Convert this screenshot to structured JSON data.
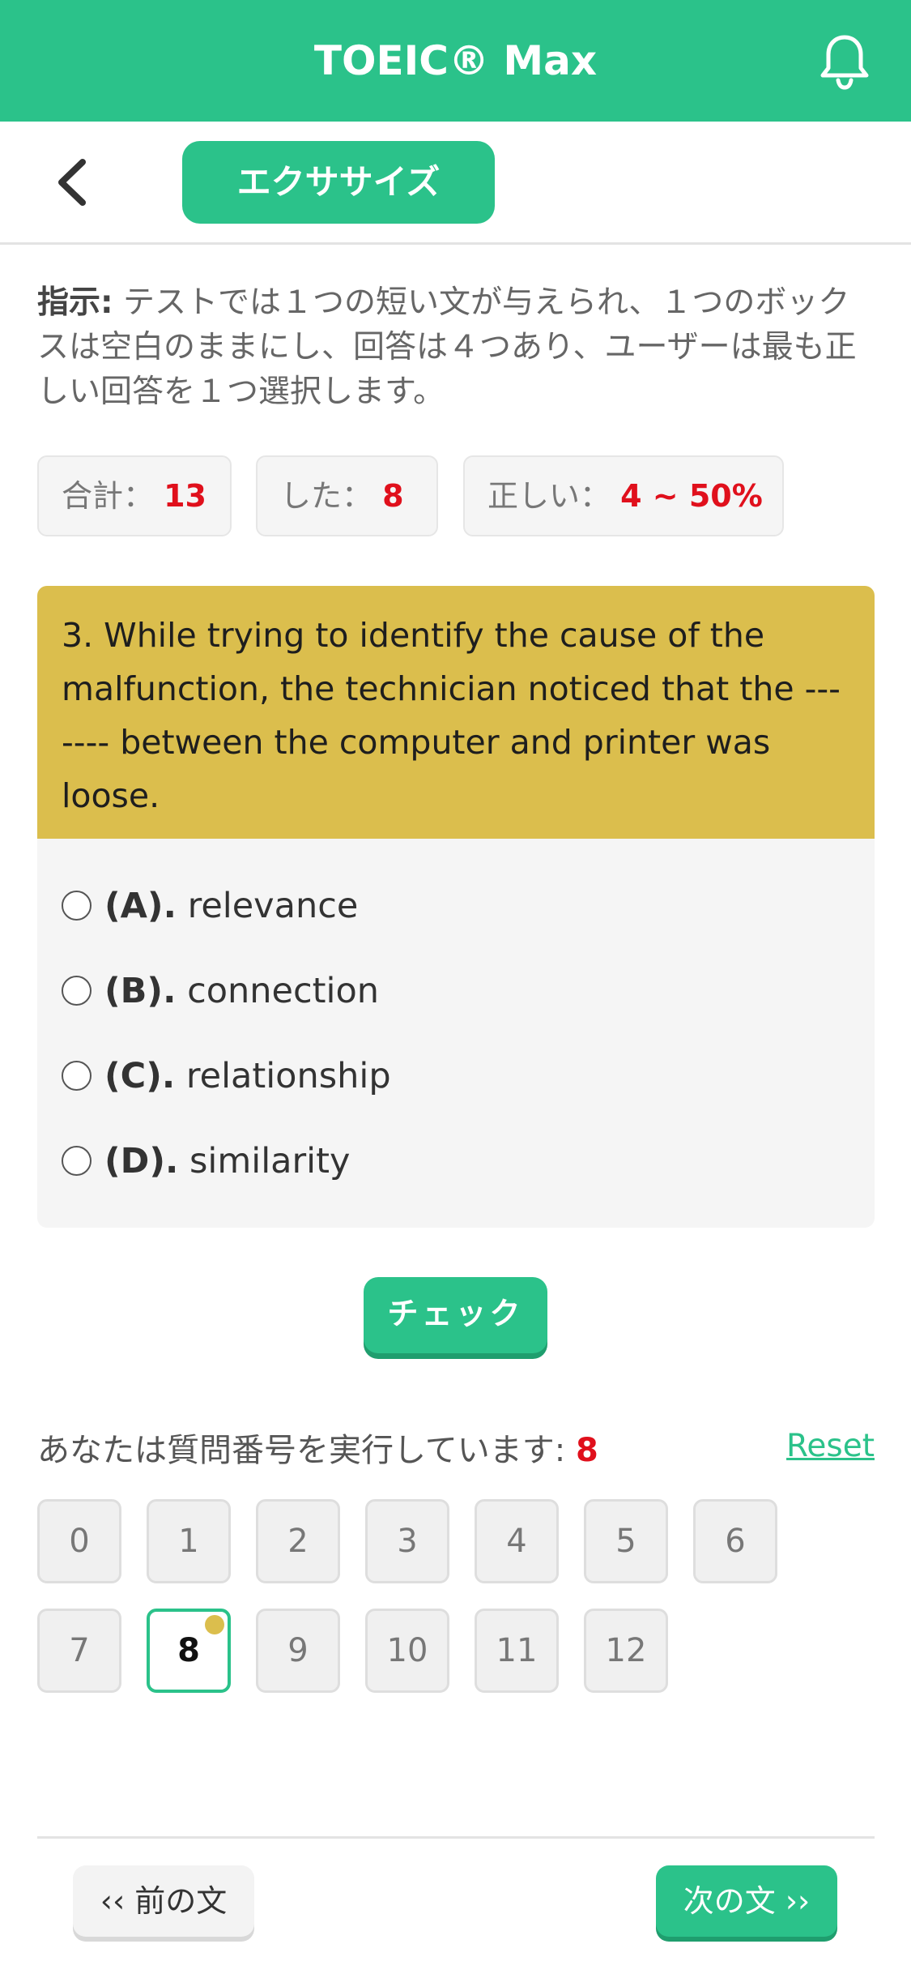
{
  "header": {
    "title": "TOEIC® Max",
    "bell_icon": "bell-icon"
  },
  "subbar": {
    "back_icon": "chevron-left-icon",
    "tab_label": "エクササイズ"
  },
  "instruction": {
    "label": "指示:",
    "text": " テストでは１つの短い文が与えられ、１つのボックスは空白のままにし、回答は４つあり、ユーザーは最も正しい回答を１つ選択します。"
  },
  "stats": [
    {
      "label": "合計：",
      "value": "13"
    },
    {
      "label": "した：",
      "value": "8"
    },
    {
      "label": "正しい：",
      "value": "4 ~ 50%"
    }
  ],
  "question": {
    "text": "3. While trying to identify the cause of the malfunction, the technician noticed that the ------- between the computer and printer was loose."
  },
  "options": [
    {
      "key": "(A).",
      "text": "relevance"
    },
    {
      "key": "(B).",
      "text": "connection"
    },
    {
      "key": "(C).",
      "text": "relationship"
    },
    {
      "key": "(D).",
      "text": "similarity"
    }
  ],
  "check_label": "チェック",
  "progress": {
    "label": "あなたは質問番号を実行しています: ",
    "current": "8",
    "reset_label": "Reset",
    "numbers": [
      "0",
      "1",
      "2",
      "3",
      "4",
      "5",
      "6",
      "7",
      "8",
      "9",
      "10",
      "11",
      "12"
    ]
  },
  "nav": {
    "prev_label": "‹‹ 前の文",
    "next_label": "次の文 ››"
  },
  "colors": {
    "accent": "#2bc28a",
    "question_bg": "#dbbe4d",
    "highlight": "#e0101c"
  }
}
